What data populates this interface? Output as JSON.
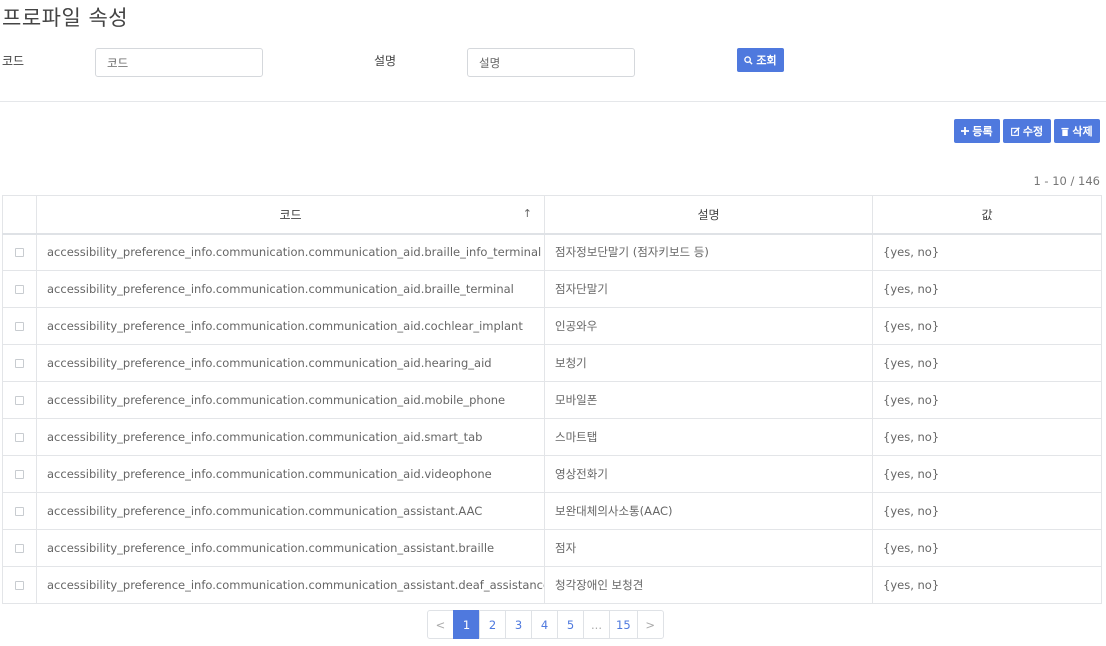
{
  "page": {
    "title": "프로파일 속성"
  },
  "search": {
    "code_label": "코드",
    "code_placeholder": "코드",
    "desc_label": "설명",
    "desc_placeholder": "설명",
    "search_button": "조회"
  },
  "toolbar": {
    "register": "등록",
    "edit": "수정",
    "delete": "삭제"
  },
  "range_text": "1 - 10 / 146",
  "table": {
    "columns": [
      "코드",
      "설명",
      "값"
    ],
    "sort_indicator": "↑",
    "rows": [
      {
        "code": "accessibility_preference_info.communication.communication_aid.braille_info_terminal",
        "desc": "점자정보단말기 (점자키보드 등)",
        "value": "{yes, no}"
      },
      {
        "code": "accessibility_preference_info.communication.communication_aid.braille_terminal",
        "desc": "점자단말기",
        "value": "{yes, no}"
      },
      {
        "code": "accessibility_preference_info.communication.communication_aid.cochlear_implant",
        "desc": "인공와우",
        "value": "{yes, no}"
      },
      {
        "code": "accessibility_preference_info.communication.communication_aid.hearing_aid",
        "desc": "보청기",
        "value": "{yes, no}"
      },
      {
        "code": "accessibility_preference_info.communication.communication_aid.mobile_phone",
        "desc": "모바일폰",
        "value": "{yes, no}"
      },
      {
        "code": "accessibility_preference_info.communication.communication_aid.smart_tab",
        "desc": "스마트탭",
        "value": "{yes, no}"
      },
      {
        "code": "accessibility_preference_info.communication.communication_aid.videophone",
        "desc": "영상전화기",
        "value": "{yes, no}"
      },
      {
        "code": "accessibility_preference_info.communication.communication_assistant.AAC",
        "desc": "보완대체의사소통(AAC)",
        "value": "{yes, no}"
      },
      {
        "code": "accessibility_preference_info.communication.communication_assistant.braille",
        "desc": "점자",
        "value": "{yes, no}"
      },
      {
        "code": "accessibility_preference_info.communication.communication_assistant.deaf_assistance_dog",
        "desc": "청각장애인 보청견",
        "value": "{yes, no}"
      }
    ]
  },
  "pagination": {
    "prev": "<",
    "pages": [
      "1",
      "2",
      "3",
      "4",
      "5",
      "...",
      "15"
    ],
    "next": ">",
    "current": "1"
  },
  "colors": {
    "accent": "#4f79de",
    "border": "#e3e5e8"
  },
  "icons": {
    "search": "search-icon",
    "register": "plus-icon",
    "edit": "edit-icon",
    "delete": "trash-icon"
  }
}
